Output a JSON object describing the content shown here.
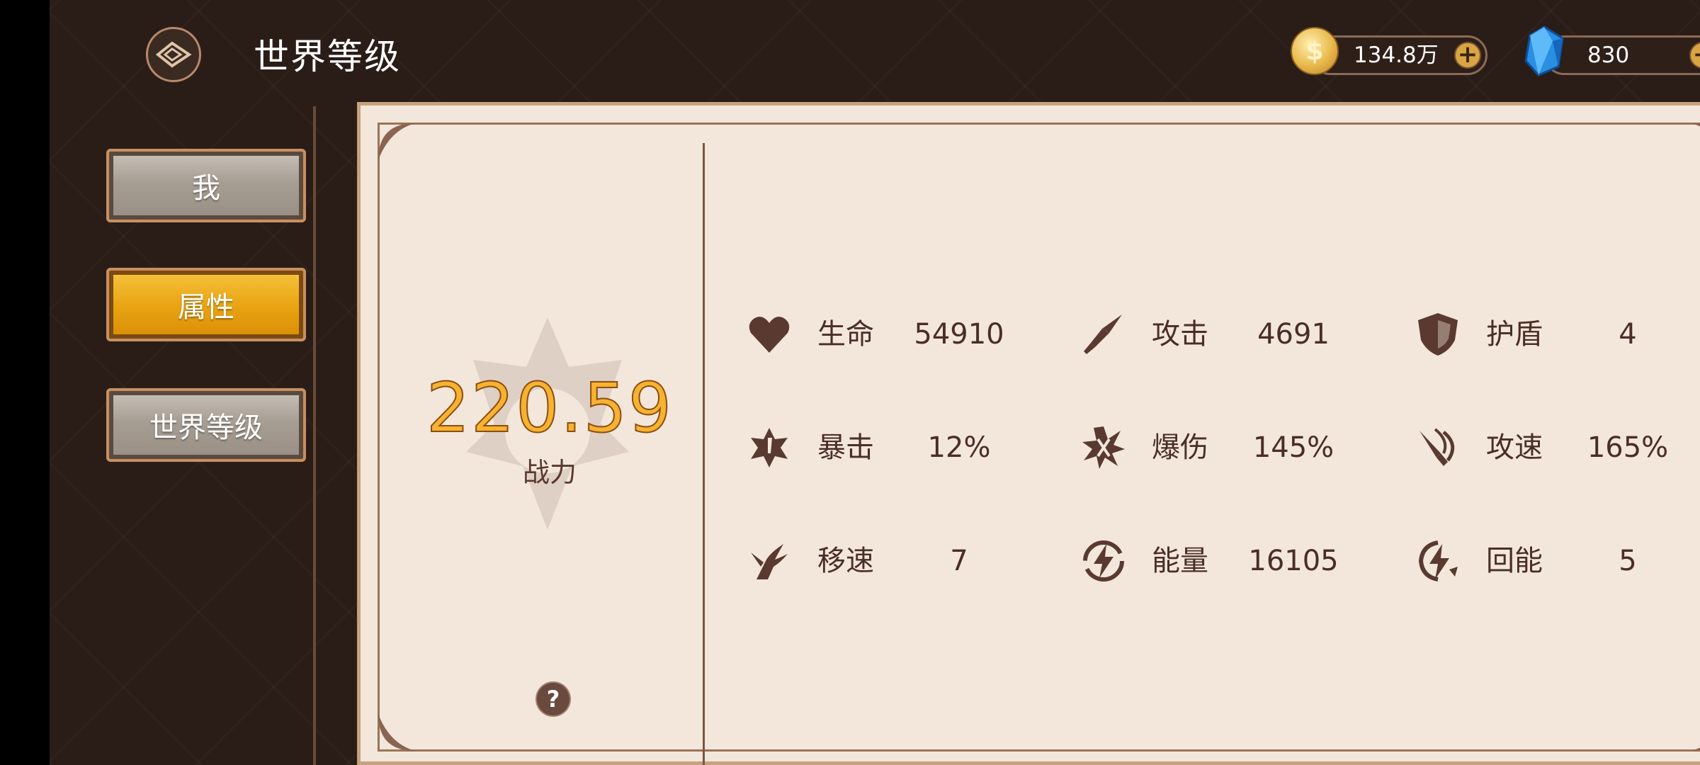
{
  "header": {
    "title": "世界等级",
    "gold": {
      "value": "134.8万",
      "icon": "gold-coin-icon",
      "add": "+"
    },
    "gems": {
      "value": "830",
      "icon": "blue-gem-icon",
      "add": "+"
    }
  },
  "sidebar": {
    "items": [
      {
        "label": "我",
        "active": false
      },
      {
        "label": "属性",
        "active": true
      },
      {
        "label": "世界等级",
        "active": false
      }
    ]
  },
  "power": {
    "value": "220.59",
    "label": "战力",
    "help": "?"
  },
  "stats": [
    {
      "label": "生命",
      "value": "54910",
      "icon": "heart-icon"
    },
    {
      "label": "攻击",
      "value": "4691",
      "icon": "sword-icon"
    },
    {
      "label": "护盾",
      "value": "4",
      "icon": "shield-icon"
    },
    {
      "label": "暴击",
      "value": "12%",
      "icon": "crit-icon"
    },
    {
      "label": "爆伤",
      "value": "145%",
      "icon": "crit-damage-icon"
    },
    {
      "label": "攻速",
      "value": "165%",
      "icon": "attack-speed-icon"
    },
    {
      "label": "移速",
      "value": "7",
      "icon": "wing-boot-icon"
    },
    {
      "label": "能量",
      "value": "16105",
      "icon": "energy-icon"
    },
    {
      "label": "回能",
      "value": "5",
      "icon": "energy-regen-icon"
    }
  ],
  "colors": {
    "background": "#2a1d17",
    "panel": "#f3e7dc",
    "active_tab": "#e9a514",
    "power_text": "#f7b230",
    "stat_text": "#4a2e24"
  }
}
